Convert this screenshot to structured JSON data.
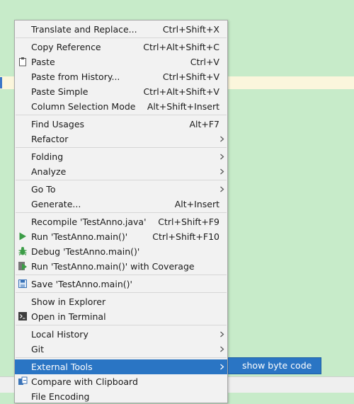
{
  "menu": {
    "items": [
      {
        "label": "Translate and Replace...",
        "shortcut": "Ctrl+Shift+X",
        "icon": null,
        "submenu": false
      },
      {
        "label": "Copy Reference",
        "shortcut": "Ctrl+Alt+Shift+C",
        "icon": null,
        "submenu": false
      },
      {
        "label": "Paste",
        "shortcut": "Ctrl+V",
        "icon": "paste-icon",
        "submenu": false
      },
      {
        "label": "Paste from History...",
        "shortcut": "Ctrl+Shift+V",
        "icon": null,
        "submenu": false
      },
      {
        "label": "Paste Simple",
        "shortcut": "Ctrl+Alt+Shift+V",
        "icon": null,
        "submenu": false
      },
      {
        "label": "Column Selection Mode",
        "shortcut": "Alt+Shift+Insert",
        "icon": null,
        "submenu": false
      },
      {
        "label": "Find Usages",
        "shortcut": "Alt+F7",
        "icon": null,
        "submenu": false
      },
      {
        "label": "Refactor",
        "shortcut": "",
        "icon": null,
        "submenu": true
      },
      {
        "label": "Folding",
        "shortcut": "",
        "icon": null,
        "submenu": true
      },
      {
        "label": "Analyze",
        "shortcut": "",
        "icon": null,
        "submenu": true
      },
      {
        "label": "Go To",
        "shortcut": "",
        "icon": null,
        "submenu": true
      },
      {
        "label": "Generate...",
        "shortcut": "Alt+Insert",
        "icon": null,
        "submenu": false
      },
      {
        "label": "Recompile 'TestAnno.java'",
        "shortcut": "Ctrl+Shift+F9",
        "icon": null,
        "submenu": false
      },
      {
        "label": "Run 'TestAnno.main()'",
        "shortcut": "Ctrl+Shift+F10",
        "icon": "run-icon",
        "submenu": false
      },
      {
        "label": "Debug 'TestAnno.main()'",
        "shortcut": "",
        "icon": "debug-icon",
        "submenu": false
      },
      {
        "label": "Run 'TestAnno.main()' with Coverage",
        "shortcut": "",
        "icon": "coverage-icon",
        "submenu": false
      },
      {
        "label": "Save 'TestAnno.main()'",
        "shortcut": "",
        "icon": "save-config-icon",
        "submenu": false
      },
      {
        "label": "Show in Explorer",
        "shortcut": "",
        "icon": null,
        "submenu": false
      },
      {
        "label": "Open in Terminal",
        "shortcut": "",
        "icon": "terminal-icon",
        "submenu": false
      },
      {
        "label": "Local History",
        "shortcut": "",
        "icon": null,
        "submenu": true
      },
      {
        "label": "Git",
        "shortcut": "",
        "icon": null,
        "submenu": true
      },
      {
        "label": "External Tools",
        "shortcut": "",
        "icon": null,
        "submenu": true,
        "selected": true
      },
      {
        "label": "Compare with Clipboard",
        "shortcut": "",
        "icon": "compare-icon",
        "submenu": false
      },
      {
        "label": "File Encoding",
        "shortcut": "",
        "icon": null,
        "submenu": false
      }
    ]
  },
  "submenu": {
    "label": "show byte code"
  },
  "colors": {
    "editor_bg": "#c7ebc9",
    "selection": "#2a75c4",
    "menu_bg": "#f2f2f2",
    "run_green": "#3c9d47"
  }
}
